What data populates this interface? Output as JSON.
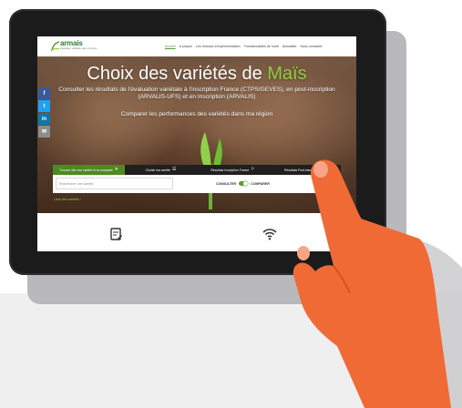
{
  "site": {
    "logo_text": "armais",
    "logo_tagline": "Évaluation variétale maïs et sorgho",
    "nav": [
      "Accueil",
      "A propos",
      "Les réseaux d'expérimentation",
      "Fonctionnalités de l'outil",
      "Actualités",
      "Nous contacter"
    ],
    "nav_active_index": 0
  },
  "hero": {
    "title_prefix": "Choix des variétés de ",
    "title_accent": "Maïs",
    "subtitle": "Consulter les résultats de l'évaluation variétale à l'inscription France (CTPS/GEVES), en post-inscription (ARVALIS-UFS) et en Inscription (ARVALIS)",
    "compare_text": "Comparer les performances des variétés dans ma région"
  },
  "social": [
    {
      "label": "f",
      "icon": "facebook-icon",
      "color": "#3b5998"
    },
    {
      "label": "t",
      "icon": "twitter-icon",
      "color": "#1da1f2"
    },
    {
      "label": "in",
      "icon": "linkedin-icon",
      "color": "#0e76a8"
    },
    {
      "label": "✉",
      "icon": "mail-icon",
      "color": "#8d8d8d"
    }
  ],
  "tabs": [
    {
      "label": "Trouvez vite une variété et la comparer",
      "icon": "✈"
    },
    {
      "label": "Choisir ma variété",
      "icon": "☰"
    },
    {
      "label": "Résultats Inscription France",
      "icon": "⚐"
    },
    {
      "label": "Résultats Post-inscription",
      "icon": "▤"
    }
  ],
  "search": {
    "placeholder": "Rechercher une variété",
    "toggle_left": "CONSULTER",
    "toggle_right": "COMPARER",
    "link": "Liste des variétés ›"
  },
  "colors": {
    "accent": "#5aa22e",
    "hand": "#f06a36",
    "hand_shadow": "#e45a27"
  }
}
